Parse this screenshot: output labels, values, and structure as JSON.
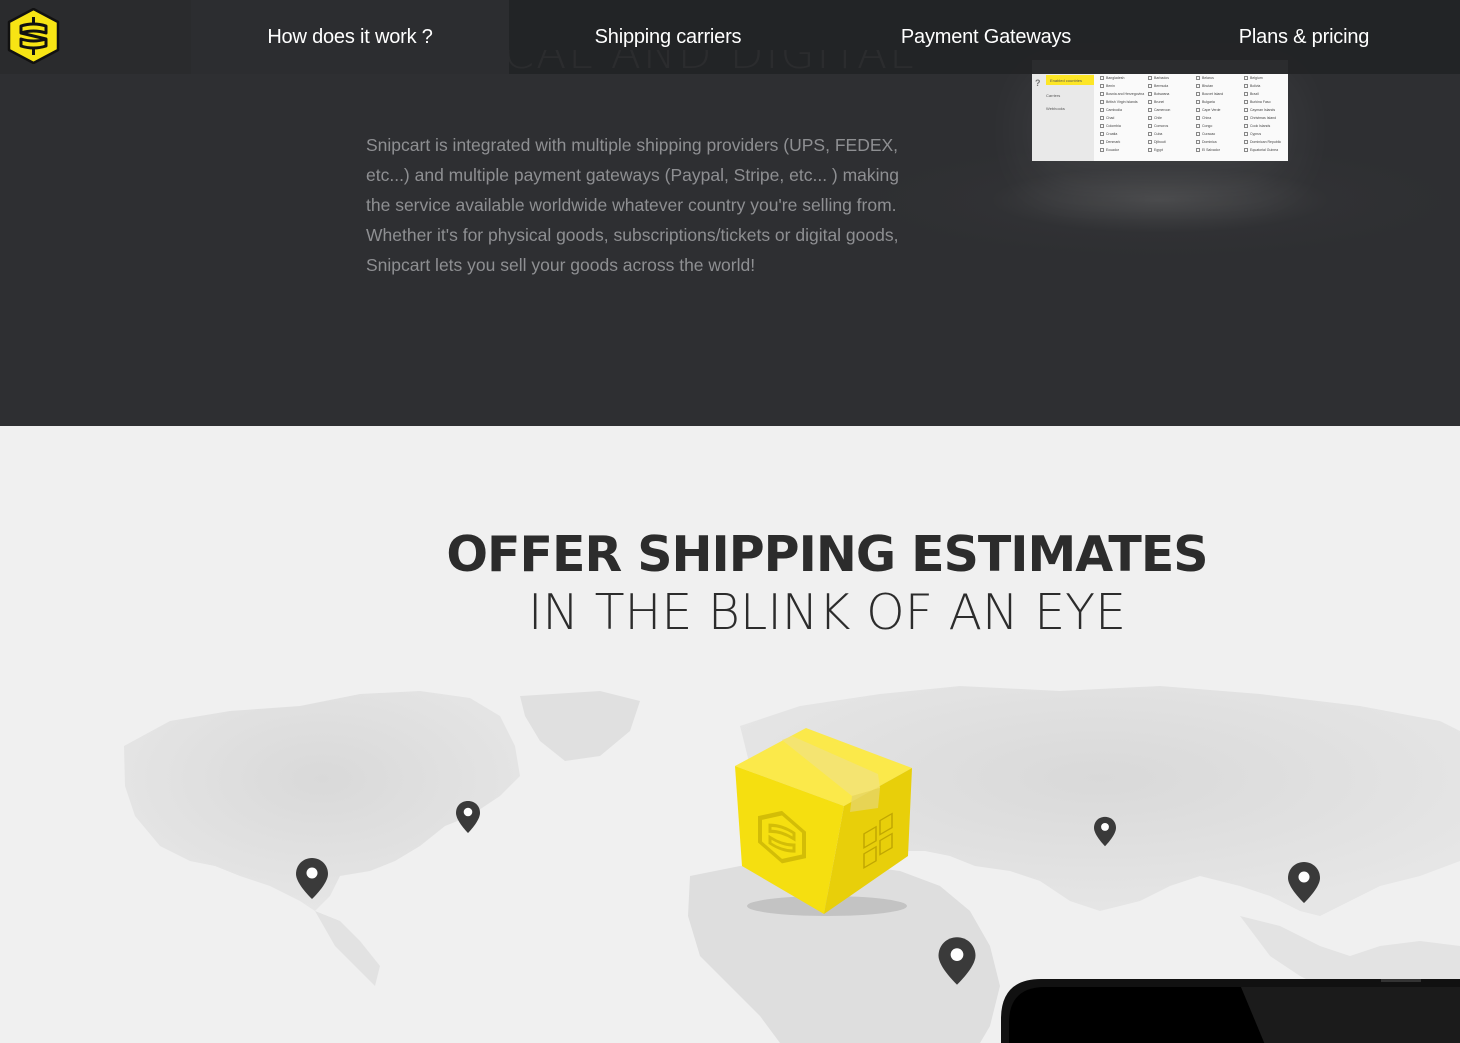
{
  "nav": {
    "logo_label": "Snipcart",
    "items": [
      {
        "label": "How does it work ?"
      },
      {
        "label": "Shipping carriers"
      },
      {
        "label": "Payment Gateways"
      },
      {
        "label": "Plans & pricing"
      }
    ]
  },
  "intro": {
    "heading": "PHYSICAL AND DIGITAL GOODS",
    "body": "Snipcart is integrated with multiple shipping providers (UPS, FEDEX, etc...) and multiple payment gateways (Paypal, Stripe, etc... ) making the service available worldwide whatever country you're selling from. Whether it's for physical goods, subscriptions/tickets or digital goods, Snipcart lets you sell your goods across the world!"
  },
  "settings_preview": {
    "help_mark": "?",
    "sidebar": [
      "Enabled countries",
      "Carriers",
      "Webhooks"
    ],
    "columns": [
      [
        "Bangladesh",
        "Benin",
        "Bosnia and Herzegovina",
        "British Virgin Islands",
        "Cambodia",
        "Chad",
        "Colombia",
        "Croatia",
        "Denmark",
        "Ecuador"
      ],
      [
        "Barbados",
        "Bermuda",
        "Botswana",
        "Brunei",
        "Cameroon",
        "Chile",
        "Comoros",
        "Cuba",
        "Djibouti",
        "Egypt"
      ],
      [
        "Belarus",
        "Bhutan",
        "Bouvet Island",
        "Bulgaria",
        "Cape Verde",
        "China",
        "Congo",
        "Curacao",
        "Dominica",
        "El Salvador"
      ],
      [
        "Belgium",
        "Bolivia",
        "Brazil",
        "Burkina Faso",
        "Cayman Islands",
        "Christmas Island",
        "Cook Islands",
        "Cyprus",
        "Dominican Republic",
        "Equatorial Guinea"
      ]
    ]
  },
  "estimates": {
    "heading_bold": "OFFER SHIPPING ESTIMATES",
    "heading_light": "IN THE BLINK OF AN EYE"
  },
  "colors": {
    "brand_yellow": "#f7e414",
    "dark_bg": "#2e2f32",
    "nav_bg": "#222325",
    "light_bg": "#f0f0f0",
    "pin": "#3a3a3a"
  },
  "icons": [
    "snipcart-logo-icon",
    "map-pin-icon",
    "package-box-icon"
  ]
}
